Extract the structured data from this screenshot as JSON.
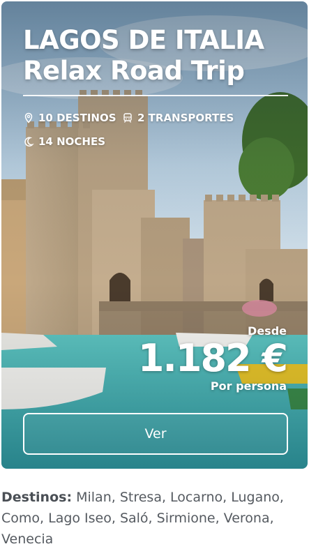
{
  "card": {
    "title_line1": "LAGOS DE ITALIA",
    "title_line2": "Relax Road Trip",
    "destinations_count": "10 DESTINOS",
    "transports_count": "2 TRANSPORTES",
    "nights_count": "14 NOCHES",
    "price_prefix": "Desde",
    "price": "1.182 €",
    "price_suffix": "Por persona",
    "cta_label": "Ver",
    "icons": [
      "location-pin-icon",
      "train-icon",
      "moon-icon"
    ]
  },
  "destinos": {
    "label": "Destinos:",
    "list": "Milan, Stresa, Locarno, Lugano, Como, Lago Iseo, Saló, Sirmione, Verona, Venecia"
  },
  "colors": {
    "sky": "#bcd3e6",
    "water": "#4fb8b8",
    "stone": "#c4ad8e",
    "text_gray": "#555a60"
  }
}
